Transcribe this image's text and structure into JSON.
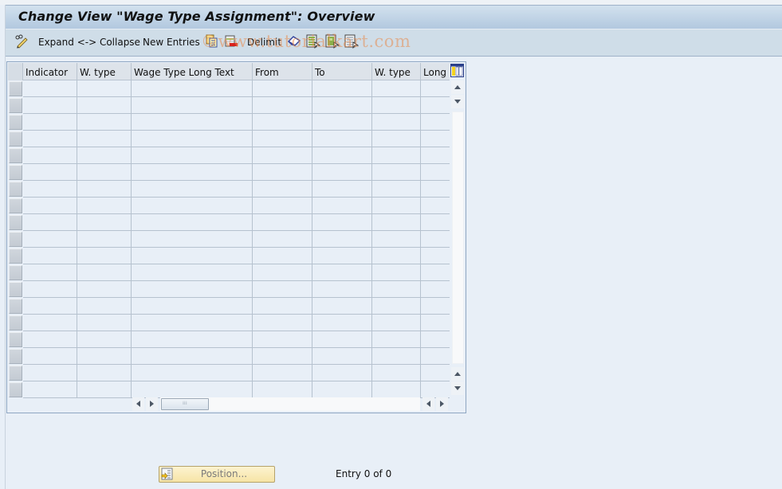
{
  "window": {
    "title": "Change View \"Wage Type Assignment\": Overview"
  },
  "toolbar": {
    "items": [
      {
        "type": "icon",
        "icon": "display-change-icon"
      },
      {
        "type": "text",
        "label": "Expand <-> Collapse"
      },
      {
        "type": "text",
        "label": "New Entries"
      },
      {
        "type": "icon",
        "icon": "copy-as-icon"
      },
      {
        "type": "icon",
        "icon": "delete-icon"
      },
      {
        "type": "text",
        "label": "Delimit"
      },
      {
        "type": "icon",
        "icon": "undo-change-icon"
      },
      {
        "type": "icon",
        "icon": "select-all-icon"
      },
      {
        "type": "icon",
        "icon": "select-block-icon"
      },
      {
        "type": "icon",
        "icon": "deselect-all-icon"
      }
    ],
    "expand_collapse_label": "Expand <-> Collapse",
    "new_entries_label": "New Entries",
    "delimit_label": "Delimit"
  },
  "watermark": "©www.tutorialkart.com",
  "table": {
    "columns": [
      "Indicator",
      "W. type",
      "Wage Type Long Text",
      "From",
      "To",
      "W. type",
      "Long t"
    ],
    "row_count": 19,
    "rows": []
  },
  "footer": {
    "position_button_label": "Position...",
    "entry_info": "Entry 0 of 0"
  },
  "colors": {
    "background": "#e8eff7",
    "title_bar": "#b2c8df",
    "toolbar": "#cfdde8",
    "position_button": "#f6e4a6",
    "watermark": "#e88c50"
  }
}
